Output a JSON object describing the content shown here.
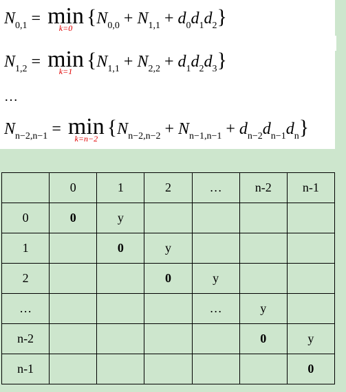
{
  "formulas": [
    {
      "lhs": "N",
      "lhs_sub": "0,1",
      "eq": "=",
      "op": "min",
      "under": "k=0",
      "t1": "N",
      "t1_sub": "0,0",
      "plus1": "+",
      "t2": "N",
      "t2_sub": "1,1",
      "plus2": "+",
      "d1": "d",
      "d1_sub": "0",
      "d2": "d",
      "d2_sub": "1",
      "d3": "d",
      "d3_sub": "2",
      "open": "{",
      "close": "}"
    },
    {
      "lhs": "N",
      "lhs_sub": "1,2",
      "eq": "=",
      "op": "min",
      "under": "k=1",
      "t1": "N",
      "t1_sub": "1,1",
      "plus1": "+",
      "t2": "N",
      "t2_sub": "2,2",
      "plus2": "+",
      "d1": "d",
      "d1_sub": "1",
      "d2": "d",
      "d2_sub": "2",
      "d3": "d",
      "d3_sub": "3",
      "open": "{",
      "close": "}"
    },
    {
      "lhs": "N",
      "lhs_sub": "n−2,n−1",
      "eq": "=",
      "op": "min",
      "under": "k=n−2",
      "t1": "N",
      "t1_sub": "n−2,n−2",
      "plus1": "+",
      "t2": "N",
      "t2_sub": "n−1,n−1",
      "plus2": "+",
      "d1": "d",
      "d1_sub": "n−2",
      "d2": "d",
      "d2_sub": "n−1",
      "d3": "d",
      "d3_sub": "n",
      "open": "{",
      "close": "}"
    }
  ],
  "ellipsis": "…",
  "table": {
    "header": [
      "",
      "0",
      "1",
      "2",
      "…",
      "n-2",
      "n-1"
    ],
    "rows": [
      [
        "0",
        "0",
        "y",
        "",
        "",
        "",
        ""
      ],
      [
        "1",
        "",
        "0",
        "y",
        "",
        "",
        ""
      ],
      [
        "2",
        "",
        "",
        "0",
        "y",
        "",
        ""
      ],
      [
        "…",
        "",
        "",
        "",
        "…",
        "y",
        ""
      ],
      [
        "n-2",
        "",
        "",
        "",
        "",
        "0",
        "y"
      ],
      [
        "n-1",
        "",
        "",
        "",
        "",
        "",
        "0"
      ]
    ],
    "bold_values": [
      "0"
    ]
  }
}
